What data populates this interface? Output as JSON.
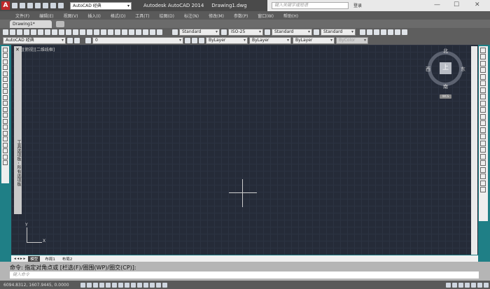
{
  "title": {
    "workspace": "AutoCAD 经典",
    "app": "Autodesk AutoCAD 2014",
    "file": "Drawing1.dwg",
    "search_placeholder": "键入关键字或短语",
    "login": "登录"
  },
  "menu": [
    "文件(F)",
    "编辑(E)",
    "视图(V)",
    "插入(I)",
    "格式(O)",
    "工具(T)",
    "绘图(D)",
    "标注(N)",
    "修改(M)",
    "参数(P)",
    "窗口(W)",
    "帮助(H)"
  ],
  "doc_tab": "Drawing1*",
  "toolbar": {
    "text_style": "Standard",
    "dim_style": "ISO-25",
    "table_style": "Standard",
    "mleader_style": "Standard",
    "workspace": "AutoCAD 经典",
    "layer": "0",
    "color": "ByLayer",
    "linetype": "ByLayer",
    "lineweight": "ByLayer",
    "plot_style": "ByColor"
  },
  "viewport_label": "[-][俯视][二维线框]",
  "palette_title": "工具选项板 - 所有选项板",
  "viewcube": {
    "top": "上",
    "north": "北",
    "south": "南",
    "east": "东",
    "west": "西",
    "ucs": "WCS"
  },
  "ucs": {
    "x": "X",
    "y": "Y"
  },
  "layout_tabs": [
    "模型",
    "布局1",
    "布局2"
  ],
  "command": {
    "history": "命令: 指定对角点或 [栏选(F)/圈围(WP)/圈交(CP)]:",
    "placeholder": "键入命令"
  },
  "status": {
    "coords": "6094.8312, 1607.9445, 0.0000"
  },
  "colors": {
    "canvas": "#252b38",
    "accent": "#c0282a",
    "frame": "#1f7f86"
  }
}
